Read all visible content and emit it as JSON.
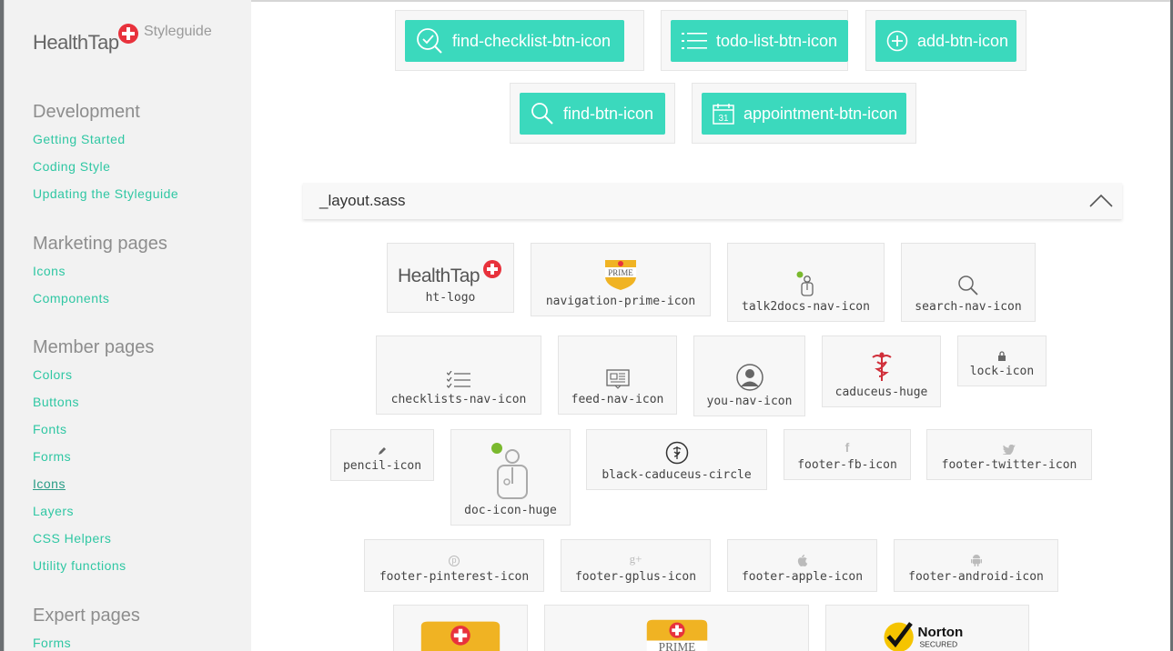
{
  "sidebar": {
    "logo_word": "HealthTap",
    "logo_sub": "Styleguide",
    "sections": [
      {
        "heading": "Development",
        "links": [
          "Getting Started",
          "Coding Style",
          "Updating the Styleguide"
        ]
      },
      {
        "heading": "Marketing pages",
        "links": [
          "Icons",
          "Components"
        ]
      },
      {
        "heading": "Member pages",
        "links": [
          "Colors",
          "Buttons",
          "Fonts",
          "Forms",
          "Icons",
          "Layers",
          "CSS Helpers",
          "Utility functions"
        ]
      },
      {
        "heading": "Expert pages",
        "links": [
          "Forms"
        ]
      }
    ],
    "active_link": "Icons"
  },
  "buttons": [
    {
      "label": "find-checklist-btn-icon",
      "icon": "find-checklist-icon"
    },
    {
      "label": "todo-list-btn-icon",
      "icon": "todo-list-icon"
    },
    {
      "label": "add-btn-icon",
      "icon": "add-icon"
    },
    {
      "label": "find-btn-icon",
      "icon": "search-icon"
    },
    {
      "label": "appointment-btn-icon",
      "icon": "calendar-icon",
      "calendar_day": "31"
    }
  ],
  "section": {
    "title": "_layout.sass",
    "toggle_icon": "chevron-up-icon"
  },
  "icons": {
    "row1": [
      "ht-logo",
      "navigation-prime-icon",
      "talk2docs-nav-icon",
      "search-nav-icon"
    ],
    "row2": [
      "checklists-nav-icon",
      "feed-nav-icon",
      "you-nav-icon",
      "caduceus-huge",
      "lock-icon"
    ],
    "row3": [
      "pencil-icon",
      "doc-icon-huge",
      "black-caduceus-circle",
      "footer-fb-icon",
      "footer-twitter-icon"
    ],
    "row4": [
      "footer-pinterest-icon",
      "footer-gplus-icon",
      "footer-apple-icon",
      "footer-android-icon"
    ]
  },
  "graphics": {
    "ht_logo_word": "HealthTap",
    "prime_word": "PRIME",
    "norton_word": "Norton",
    "norton_sub": "SECURED",
    "fb_glyph": "f",
    "gplus_glyph": "g+",
    "pinterest_glyph": "p"
  },
  "colors": {
    "accent": "#3bd9bd",
    "link": "#2fc7a3",
    "brand_red": "#e8323c",
    "prime_gold": "#f0b323",
    "status_green": "#7ab92e"
  }
}
